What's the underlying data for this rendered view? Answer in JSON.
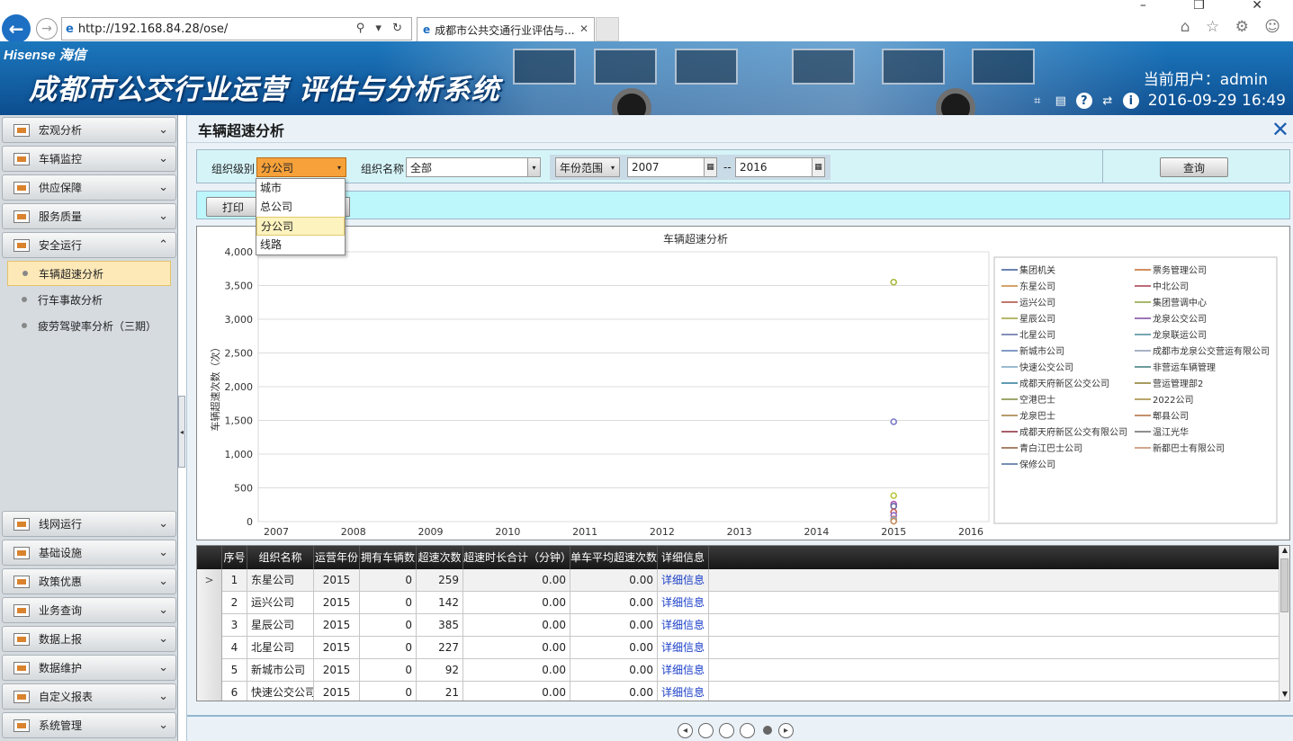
{
  "browser": {
    "url": "http://192.168.84.28/ose/",
    "tab_title": "成都市公共交通行业评估与...",
    "address_tools": "⚲ ▾ ↻",
    "tab_close": "✕",
    "window_controls": "– ❐ ✕",
    "browser_icons": "⌂ ☆ ⚙ ☺"
  },
  "header": {
    "brand": "Hisense 海信",
    "title": "成都市公交行业运营 评估与分析系统",
    "current_user_label": "当前用户：admin",
    "datetime": "2016-09-29 16:49",
    "accent": "#1c77bd"
  },
  "sidebar": {
    "top_items": [
      {
        "label": "宏观分析",
        "icon": "line-chart-icon"
      },
      {
        "label": "车辆监控",
        "icon": "vehicle-monitor-icon"
      },
      {
        "label": "供应保障",
        "icon": "supply-icon"
      },
      {
        "label": "服务质量",
        "icon": "quality-icon"
      },
      {
        "label": "安全运行",
        "icon": "safety-icon",
        "expanded": true
      }
    ],
    "sub_items": [
      {
        "label": "车辆超速分析",
        "active": true
      },
      {
        "label": "行车事故分析"
      },
      {
        "label": "疲劳驾驶率分析（三期）"
      }
    ],
    "bottom_items": [
      {
        "label": "线网运行",
        "icon": "network-icon"
      },
      {
        "label": "基础设施",
        "icon": "infrastructure-icon"
      },
      {
        "label": "政策优惠",
        "icon": "policy-icon"
      },
      {
        "label": "业务查询",
        "icon": "query-icon"
      },
      {
        "label": "数据上报",
        "icon": "report-icon"
      },
      {
        "label": "数据维护",
        "icon": "maintain-icon"
      },
      {
        "label": "自定义报表",
        "icon": "custom-report-icon"
      },
      {
        "label": "系统管理",
        "icon": "system-icon"
      }
    ]
  },
  "page": {
    "title": "车辆超速分析",
    "close": "✕"
  },
  "filters": {
    "org_level_label": "组织级别",
    "org_level_value": "分公司",
    "org_name_label": "组织名称",
    "org_name_value": "全部",
    "year_range_label": "年份范围",
    "year_from": "2007",
    "year_to": "2016",
    "year_sep": "--",
    "query_label": "查询",
    "print_label": "打印",
    "org_level_options": [
      "城市",
      "总公司",
      "分公司",
      "线路"
    ],
    "org_level_selected_index": 2
  },
  "chart_data": {
    "type": "scatter",
    "title": "车辆超速分析",
    "ylabel": "车辆超速次数（次）",
    "xlabel": "",
    "categories": [
      "2007",
      "2008",
      "2009",
      "2010",
      "2011",
      "2012",
      "2013",
      "2014",
      "2015",
      "2016"
    ],
    "ylim": [
      0,
      4000
    ],
    "yticks": [
      "0",
      "500",
      "1,000",
      "1,500",
      "2,000",
      "2,500",
      "3,000",
      "3,500",
      "4,000"
    ],
    "grid": true,
    "legend_position": "right",
    "legend": [
      {
        "name": "集团机关",
        "color": "#3b5a9a"
      },
      {
        "name": "票务管理公司",
        "color": "#c46a2a"
      },
      {
        "name": "东星公司",
        "color": "#c7863a"
      },
      {
        "name": "中北公司",
        "color": "#a83a4a"
      },
      {
        "name": "运兴公司",
        "color": "#a84a3a"
      },
      {
        "name": "集团营调中心",
        "color": "#8aa23a"
      },
      {
        "name": "星辰公司",
        "color": "#a0a23a"
      },
      {
        "name": "龙泉公交公司",
        "color": "#7a4aa2"
      },
      {
        "name": "北星公司",
        "color": "#5a6aa2"
      },
      {
        "name": "龙泉联运公司",
        "color": "#4a8a9a"
      },
      {
        "name": "新城市公司",
        "color": "#5a7ab2"
      },
      {
        "name": "成都市龙泉公交营运有限公司",
        "color": "#8a9ab2"
      },
      {
        "name": "快速公交公司",
        "color": "#7aa2c2"
      },
      {
        "name": "非营运车辆管理",
        "color": "#3a7a7a"
      },
      {
        "name": "成都天府新区公交公司",
        "color": "#2a7a9a"
      },
      {
        "name": "营运管理部2",
        "color": "#8a7a2a"
      },
      {
        "name": "空港巴士",
        "color": "#7a8a3a"
      },
      {
        "name": "2022公司",
        "color": "#a28a3a"
      },
      {
        "name": "龙泉巴士",
        "color": "#a27a3a"
      },
      {
        "name": "郫县公司",
        "color": "#b26a3a"
      },
      {
        "name": "成都天府新区公交有限公司",
        "color": "#8a2a3a"
      },
      {
        "name": "温江光华",
        "color": "#6a6a6a"
      },
      {
        "name": "青白江巴士公司",
        "color": "#8a5a3a"
      },
      {
        "name": "新都巴士有限公司",
        "color": "#c28a6a"
      },
      {
        "name": "保修公司",
        "color": "#4a6a9a"
      }
    ],
    "points": [
      {
        "x": "2015",
        "y": 3550,
        "color": "#a8b83a"
      },
      {
        "x": "2015",
        "y": 1480,
        "color": "#7a7ac8"
      },
      {
        "x": "2015",
        "y": 385,
        "color": "#b8c83a"
      },
      {
        "x": "2015",
        "y": 259,
        "color": "#b25ab2"
      },
      {
        "x": "2015",
        "y": 227,
        "color": "#6a6aa2"
      },
      {
        "x": "2015",
        "y": 142,
        "color": "#c85a5a"
      },
      {
        "x": "2015",
        "y": 92,
        "color": "#8a6ac8"
      },
      {
        "x": "2015",
        "y": 40,
        "color": "#c87a7a"
      },
      {
        "x": "2015",
        "y": 21,
        "color": "#7ab2c8"
      },
      {
        "x": "2015",
        "y": 5,
        "color": "#c88a5a"
      }
    ]
  },
  "grid": {
    "columns": [
      "序号",
      "组织名称",
      "运营年份",
      "拥有车辆数",
      "超速次数",
      "超速时长合计（分钟）",
      "单车平均超速次数",
      "详细信息"
    ],
    "rows": [
      [
        "1",
        "东星公司",
        "2015",
        "0",
        "259",
        "0.00",
        "0.00",
        "详细信息"
      ],
      [
        "2",
        "运兴公司",
        "2015",
        "0",
        "142",
        "0.00",
        "0.00",
        "详细信息"
      ],
      [
        "3",
        "星辰公司",
        "2015",
        "0",
        "385",
        "0.00",
        "0.00",
        "详细信息"
      ],
      [
        "4",
        "北星公司",
        "2015",
        "0",
        "227",
        "0.00",
        "0.00",
        "详细信息"
      ],
      [
        "5",
        "新城市公司",
        "2015",
        "0",
        "92",
        "0.00",
        "0.00",
        "详细信息"
      ],
      [
        "6",
        "快速公交公司",
        "2015",
        "0",
        "21",
        "0.00",
        "0.00",
        "详细信息"
      ]
    ],
    "current_row_marker": ">"
  },
  "pager": {
    "prev": "◂",
    "next": "▸"
  }
}
